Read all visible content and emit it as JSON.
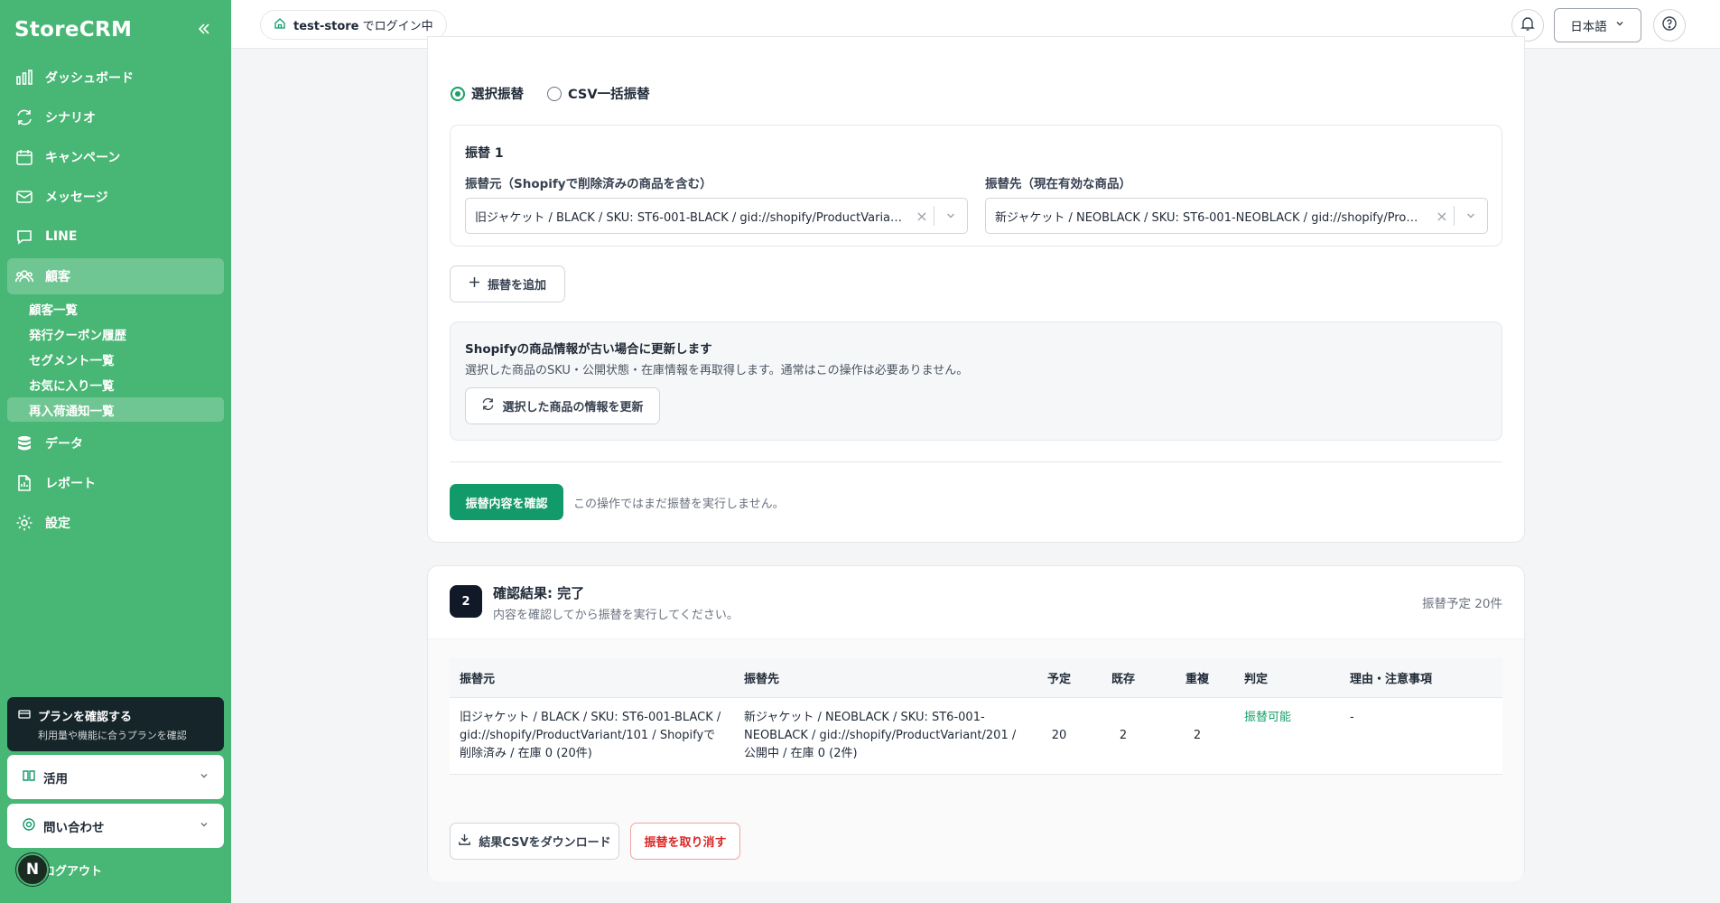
{
  "app": {
    "name": "StoreCRM"
  },
  "sidebar": {
    "items": [
      {
        "label": "ダッシュボード",
        "icon": "bar-chart-icon"
      },
      {
        "label": "シナリオ",
        "icon": "refresh-icon"
      },
      {
        "label": "キャンペーン",
        "icon": "calendar-icon"
      },
      {
        "label": "メッセージ",
        "icon": "mail-icon"
      },
      {
        "label": "LINE",
        "icon": "chat-icon"
      },
      {
        "label": "顧客",
        "icon": "users-icon"
      },
      {
        "label": "データ",
        "icon": "database-icon"
      },
      {
        "label": "レポート",
        "icon": "file-icon"
      },
      {
        "label": "設定",
        "icon": "gear-icon"
      }
    ],
    "customer_sub": [
      "顧客一覧",
      "発行クーポン履歴",
      "セグメント一覧",
      "お気に入り一覧",
      "再入荷通知一覧"
    ],
    "plan": {
      "title": "プランを確認する",
      "subtitle": "利用量や機能に合うプランを確認"
    },
    "accordions": [
      {
        "label": "活用"
      },
      {
        "label": "問い合わせ"
      }
    ],
    "logout": "ログアウト",
    "avatar_initial": "N"
  },
  "header": {
    "store": "test-store",
    "store_suffix": "でログイン中",
    "language": "日本語"
  },
  "form": {
    "modes": [
      "選択振替",
      "CSV一括振替"
    ],
    "transfer_title": "振替 1",
    "from_label": "振替元（Shopifyで削除済みの商品を含む）",
    "to_label": "振替先（現在有効な商品）",
    "from_value": "旧ジャケット / BLACK / SKU: ST6-001-BLACK / gid://shopify/ProductVariant/101 / Shopifyで削除済み / 在庫 0 (20件)",
    "to_value": "新ジャケット / NEOBLACK / SKU: ST6-001-NEOBLACK / gid://shopify/ProductVariant/201 / 公開中 / 在庫 0 (2件)",
    "add_label": "振替を追加",
    "info_title": "Shopifyの商品情報が古い場合に更新します",
    "info_desc": "選択した商品のSKU・公開状態・在庫情報を再取得します。通常はこの操作は必要ありません。",
    "refresh_label": "選択した商品の情報を更新",
    "confirm_label": "振替内容を確認",
    "confirm_note": "この操作ではまだ振替を実行しません。"
  },
  "result": {
    "step": "2",
    "title": "確認結果: 完了",
    "subtitle": "内容を確認してから振替を実行してください。",
    "count": "振替予定 20件",
    "columns": [
      "振替元",
      "振替先",
      "予定",
      "既存",
      "重複",
      "判定",
      "理由・注意事項"
    ],
    "rows": [
      {
        "from": "旧ジャケット / BLACK / SKU: ST6-001-BLACK / gid://shopify/ProductVariant/101 / Shopifyで削除済み / 在庫 0 (20件)",
        "to": "新ジャケット / NEOBLACK / SKU: ST6-001-NEOBLACK / gid://shopify/ProductVariant/201 / 公開中 / 在庫 0 (2件)",
        "planned": "20",
        "existing": "2",
        "duplicate": "2",
        "judgement": "振替可能",
        "note": "-"
      }
    ],
    "download_label": "結果CSVをダウンロード",
    "cancel_label": "振替を取り消す"
  },
  "colors": {
    "sidebar": "#48b674",
    "primary": "#139a6a",
    "danger": "#dc2626"
  }
}
